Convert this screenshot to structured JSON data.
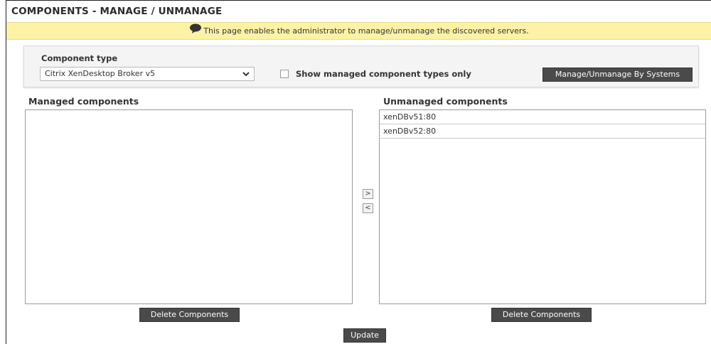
{
  "page": {
    "title": "COMPONENTS - MANAGE / UNMANAGE",
    "banner_text": "This page enables the administrator to manage/unmanage the discovered servers.",
    "banner_icon": "speech-bubble-icon"
  },
  "filter": {
    "component_type_label": "Component type",
    "component_type_value": "Citrix XenDesktop Broker v5",
    "show_managed_label": "Show managed component types only",
    "show_managed_checked": false,
    "manage_by_systems_label": "Manage/Unmanage By Systems"
  },
  "managed": {
    "title": "Managed components",
    "items": [],
    "delete_label": "Delete Components"
  },
  "unmanaged": {
    "title": "Unmanaged components",
    "items": [
      "xenDBv51:80",
      "xenDBv52:80"
    ],
    "delete_label": "Delete Components"
  },
  "transfer": {
    "move_right": ">",
    "move_left": "<"
  },
  "actions": {
    "update_label": "Update"
  },
  "colors": {
    "banner_bg": "#fdf2a5",
    "button_bg": "#4a4a4a"
  }
}
